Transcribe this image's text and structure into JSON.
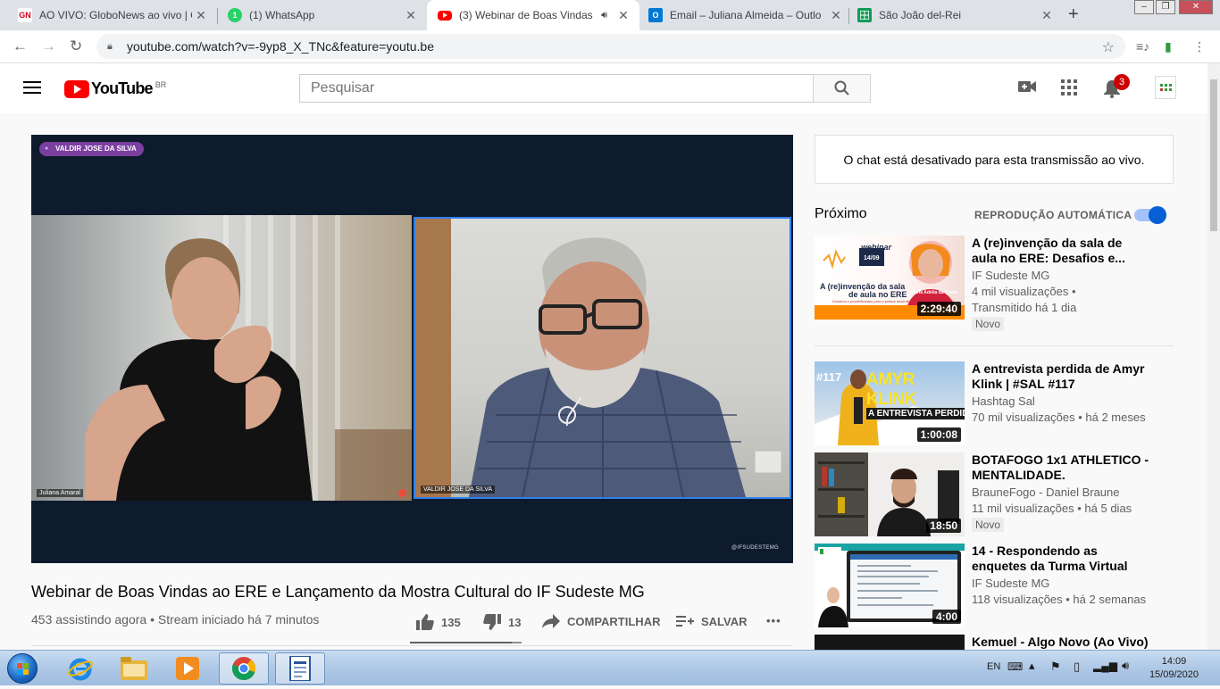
{
  "browser": {
    "tabs": [
      {
        "title": "AO VIVO: GloboNews ao vivo | G",
        "favicon": "GN",
        "color": "#d0021b"
      },
      {
        "title": "(1) WhatsApp",
        "favicon": "1",
        "color": "#25d366"
      },
      {
        "title": "(3) Webinar de Boas Vindas",
        "favicon": "yt",
        "color": "#ff0000",
        "active": true
      },
      {
        "title": "Email – Juliana Almeida – Outlo",
        "favicon": "O",
        "color": "#0078d4"
      },
      {
        "title": "São João del-Rei",
        "favicon": "S",
        "color": "#0f9d58"
      }
    ],
    "url": "youtube.com/watch?v=-9yp8_X_TNc&feature=youtu.be"
  },
  "youtube": {
    "logo_text": "YouTube",
    "country": "BR",
    "search_placeholder": "Pesquisar",
    "notifications_count": "3"
  },
  "video": {
    "speaker_badge": "VALDIR JOSE DA SILVA",
    "left_label": "Juliana Amaral",
    "right_label": "VALDIR JOSE DA SILVA",
    "watermark": "@IFSUDESTEMG",
    "title": "Webinar de Boas Vindas ao ERE e Lançamento da Mostra Cultural do IF Sudeste MG",
    "meta": "453 assistindo agora • Stream iniciado há 7 minutos",
    "likes": "135",
    "dislikes": "13",
    "share_label": "COMPARTILHAR",
    "save_label": "SALVAR",
    "more_label": "•••",
    "like_ratio": 0.912
  },
  "sidebar": {
    "chat_disabled": "O chat está desativado para esta transmissão ao vivo.",
    "next_label": "Próximo",
    "autoplay_label": "REPRODUÇÃO AUTOMÁTICA",
    "autoplay_on": true,
    "recommendations": [
      {
        "title": "A (re)invenção da sala de aula no ERE: Desafios e...",
        "channel": "IF Sudeste MG",
        "views": "4 mil visualizações •",
        "age": "Transmitido há 1 dia",
        "badge": "Novo",
        "duration": "2:29:40",
        "thumb_text": {
          "t1": "webinar",
          "t2": "A (re)invenção da sala",
          "t3": "de aula no ERE",
          "t4": "Desafios e possibilidades para a prática docente",
          "t5": "Maria Adélia da Costa",
          "t6": "14/09"
        }
      },
      {
        "title": "A entrevista perdida de Amyr Klink | #SAL #117",
        "channel": "Hashtag Sal",
        "views": "70 mil visualizações • há 2 meses",
        "age": "",
        "badge": "",
        "duration": "1:00:08",
        "thumb_text": {
          "t1": "#117",
          "t2": "AMYR KLINK",
          "t3": "A ENTREVISTA PERDIDA"
        }
      },
      {
        "title": "BOTAFOGO 1x1 ATHLETICO - MENTALIDADE.",
        "channel": "BrauneFogo - Daniel Braune",
        "views": "11 mil visualizações • há 5 dias",
        "age": "",
        "badge": "Novo",
        "duration": "18:50"
      },
      {
        "title": "14 - Respondendo as enquetes da Turma Virtual",
        "channel": "IF Sudeste MG",
        "views": "118 visualizações • há 2 semanas",
        "age": "",
        "badge": "",
        "duration": "4:00"
      },
      {
        "title": "Kemuel - Algo Novo (Ao Vivo)",
        "channel": "",
        "views": "",
        "age": "",
        "badge": "",
        "duration": ""
      }
    ]
  },
  "taskbar": {
    "lang": "EN",
    "time": "14:09",
    "date": "15/09/2020"
  },
  "colors": {
    "yt_red": "#ff0000",
    "accent_blue": "#065fd4",
    "player_bg": "#0e1b2d",
    "speaker_purple": "#7b3fa0"
  }
}
